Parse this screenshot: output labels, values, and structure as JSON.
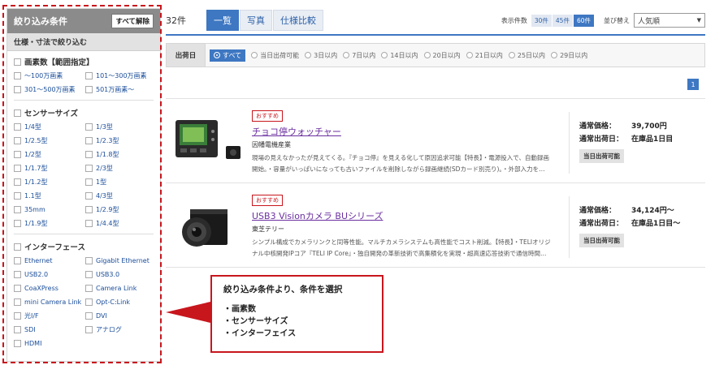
{
  "sidebar": {
    "title": "絞り込み条件",
    "clear_label": "すべて解除",
    "sub_title": "仕様・寸法で絞り込む",
    "groups": [
      {
        "title": "画素数【範囲指定】",
        "options": [
          "～100万画素",
          "101～300万画素",
          "301～500万画素",
          "501万画素～"
        ]
      },
      {
        "title": "センサーサイズ",
        "options": [
          "1/4型",
          "1/3型",
          "1/2.5型",
          "1/2.3型",
          "1/2型",
          "1/1.8型",
          "1/1.7型",
          "2/3型",
          "1/1.2型",
          "1型",
          "1.1型",
          "4/3型",
          "35mm",
          "1/2.9型",
          "1/1.9型",
          "1/4.4型"
        ]
      },
      {
        "title": "インターフェース",
        "options": [
          "Ethernet",
          "Gigabit Ethernet",
          "USB2.0",
          "USB3.0",
          "CoaXPress",
          "Camera Link",
          "mini Camera Link",
          "Opt-C:Link",
          "光I/F",
          "DVI",
          "SDI",
          "アナログ",
          "HDMI"
        ]
      }
    ]
  },
  "topbar": {
    "count": "32件",
    "view_tabs": [
      "一覧",
      "写真",
      "仕様比較"
    ],
    "per_page_label": "表示件数",
    "per_page_options": [
      "30件",
      "45件",
      "60件"
    ],
    "sort_label": "並び替え",
    "sort_value": "人気順"
  },
  "ship": {
    "label": "出荷日",
    "options": [
      "すべて",
      "当日出荷可能",
      "3日以内",
      "7日以内",
      "14日以内",
      "20日以内",
      "21日以内",
      "25日以内",
      "29日以内"
    ]
  },
  "pager": {
    "current": "1"
  },
  "products": [
    {
      "badge": "おすすめ",
      "name": "チョコ停ウォッチャー",
      "maker": "因幡電機産業",
      "desc": "現場の見えなかったが見えてくる。『チョコ停』を見える化して原因追求可能【特長】・電源投入で、自動録画開始。・容量がいっぱいになっても古いファイルを削除しながら録画継続(SDカード別売り)。・外部入力を…",
      "price_label": "通常価格：",
      "price": "39,700円",
      "ship_label": "通常出荷日：",
      "ship_value": "在庫品1日目",
      "tag": "当日出荷可能"
    },
    {
      "badge": "おすすめ",
      "name": "USB3 Visionカメラ BUシリーズ",
      "maker": "東芝テリー",
      "desc": "シンプル構成でカメラリンクと同等性能。マルチカメラシステムも高性能でコスト削減。【特長】・TELIオリジナル中核開発IPコア『TELI IP Core』・独自開発の革新技術で高集積化を実現・超高速応答技術で通信時間…",
      "price_label": "通常価格：",
      "price": "34,124円～",
      "ship_label": "通常出荷日：",
      "ship_value": "在庫品1日目～",
      "tag": "当日出荷可能"
    }
  ],
  "callout": {
    "title": "絞り込み条件より、条件を選択",
    "items": [
      "・画素数",
      "・センサーサイズ",
      "・インターフェイス"
    ]
  },
  "colors": {
    "accent": "#3e77c2",
    "highlight": "#c8161d"
  }
}
